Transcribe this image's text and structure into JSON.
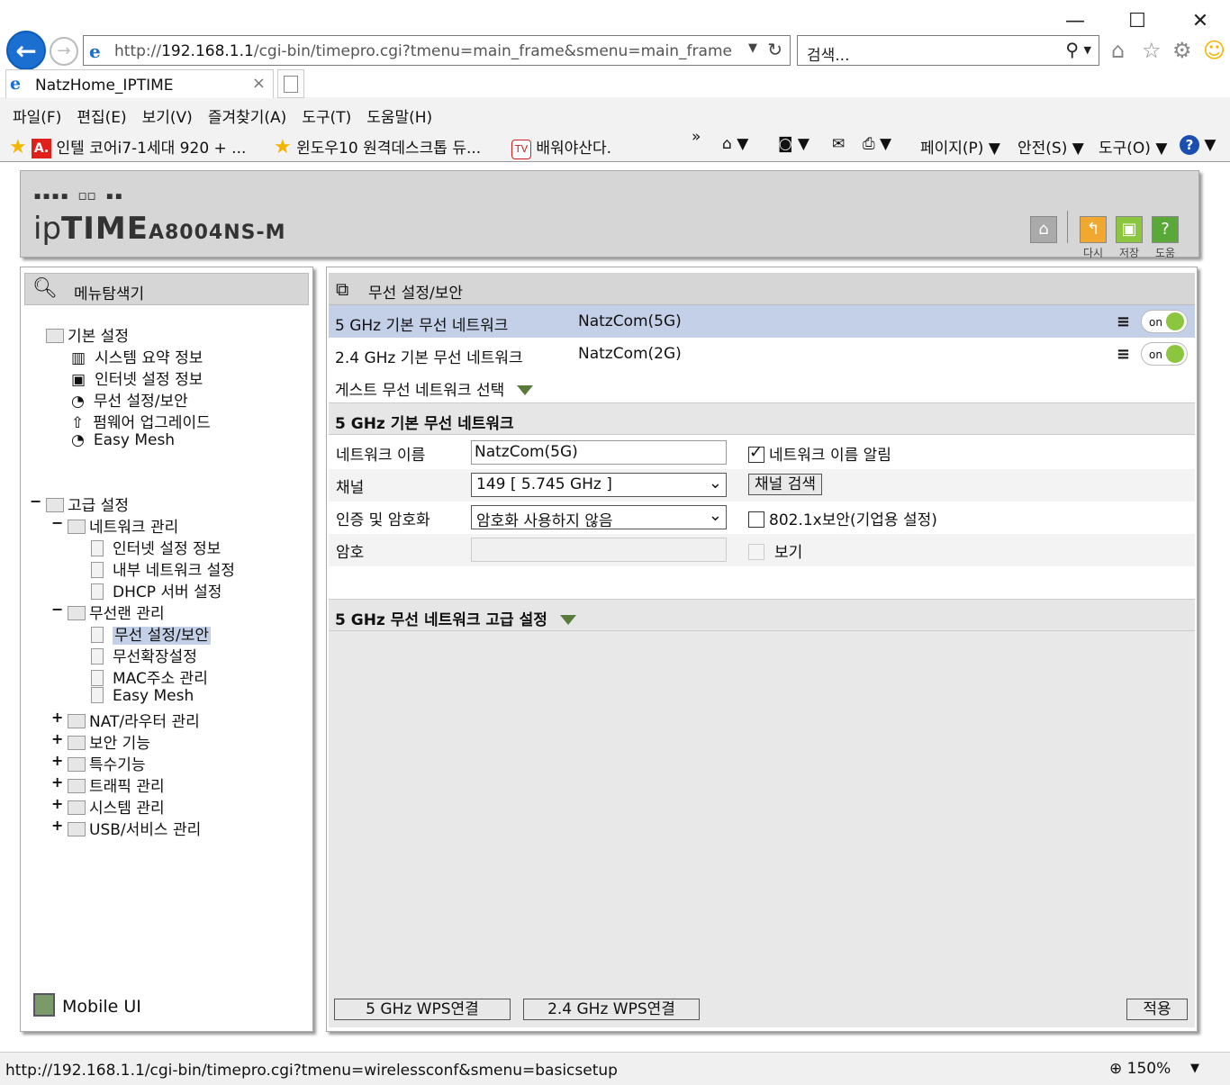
{
  "window": {
    "minimize": "—",
    "maximize": "☐",
    "close": "✕"
  },
  "address": {
    "url_prefix": "http://",
    "url_host": "192.168.1.1",
    "url_path": "/cgi-bin/timepro.cgi?tmenu=main_frame&smenu=main_frame"
  },
  "search": {
    "placeholder": "검색..."
  },
  "tab": {
    "title": "NatzHome_IPTIME"
  },
  "menu": [
    "파일(F)",
    "편집(E)",
    "보기(V)",
    "즐겨찾기(A)",
    "도구(T)",
    "도움말(H)"
  ],
  "favorites": [
    "인텔 코어i7-1세대 920 + ...",
    "윈도우10 원격데스크톱 듀...",
    "배워야산다."
  ],
  "commandbar": {
    "page": "페이지(P)",
    "safety": "안전(S)",
    "tools": "도구(O)"
  },
  "router": {
    "brand_dots": "▪▪▪▪ ◻◻ ▪▪",
    "brand_ip": "ip",
    "brand_time": "TIME",
    "model": "A8004NS-M",
    "header_buttons": [
      "다시",
      "저장",
      "도움"
    ]
  },
  "left": {
    "title": "메뉴탐색기",
    "basic": {
      "label": "기본 설정",
      "items": [
        "시스템 요약 정보",
        "인터넷 설정 정보",
        "무선 설정/보안",
        "펌웨어 업그레이드",
        "Easy Mesh"
      ]
    },
    "advanced": {
      "label": "고급 설정",
      "network": {
        "label": "네트워크 관리",
        "items": [
          "인터넷 설정 정보",
          "내부 네트워크 설정",
          "DHCP 서버 설정"
        ]
      },
      "wireless": {
        "label": "무선랜 관리",
        "items": [
          "무선 설정/보안",
          "무선확장설정",
          "MAC주소 관리",
          "Easy Mesh"
        ]
      },
      "others": [
        "NAT/라우터 관리",
        "보안 기능",
        "특수기능",
        "트래픽 관리",
        "시스템 관리",
        "USB/서비스 관리"
      ]
    },
    "mobile": "Mobile UI"
  },
  "right": {
    "title": "무선 설정/보안",
    "networks": [
      {
        "band": "5 GHz 기본 무선 네트워크",
        "ssid": "NatzCom(5G)",
        "toggle": "on"
      },
      {
        "band": "2.4 GHz 기본 무선 네트워크",
        "ssid": "NatzCom(2G)",
        "toggle": "on"
      }
    ],
    "guest": "게스트 무선 네트워크 선택",
    "section": "5 GHz 기본 무선 네트워크",
    "form": {
      "name_label": "네트워크 이름",
      "name_value": "NatzCom(5G)",
      "broadcast_label": "네트워크 이름 알림",
      "channel_label": "채널",
      "channel_value": "149 [ 5.745 GHz ]",
      "channel_search": "채널 검색",
      "auth_label": "인증 및 암호화",
      "auth_value": "암호화 사용하지 않음",
      "dot1x_label": "802.1x보안(기업용 설정)",
      "password_label": "암호",
      "show_label": "보기"
    },
    "advanced": "5 GHz 무선 네트워크 고급 설정",
    "buttons": {
      "wps5": "5 GHz WPS연결",
      "wps24": "2.4 GHz WPS연결",
      "apply": "적용"
    }
  },
  "status": {
    "url": "http://192.168.1.1/cgi-bin/timepro.cgi?tmenu=wirelessconf&smenu=basicsetup",
    "zoom": "150%"
  },
  "colors": {
    "ie_blue": "#1a6fd1",
    "selected": "#c3d0e8",
    "toggle_green": "#8cc63f",
    "panel_gray": "#d6d6d6"
  }
}
